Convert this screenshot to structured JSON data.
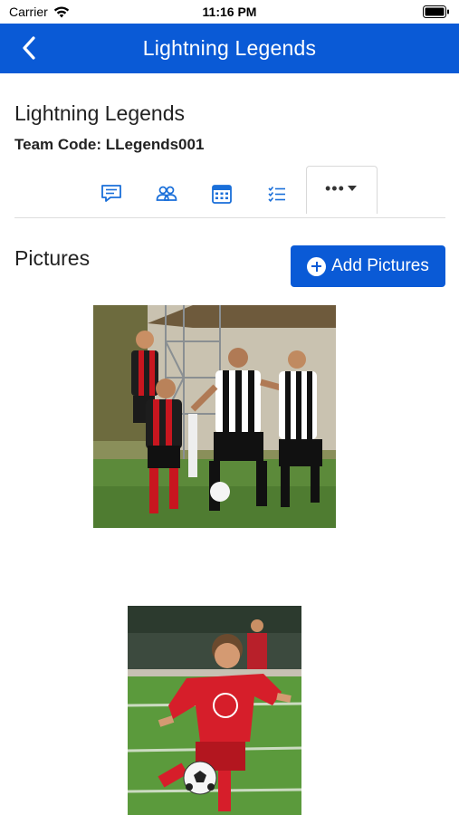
{
  "status_bar": {
    "carrier": "Carrier",
    "time": "11:16 PM"
  },
  "nav": {
    "title": "Lightning Legends",
    "back_icon": "chevron-left-icon"
  },
  "team": {
    "name": "Lightning Legends",
    "code": "Team Code: LLegends001"
  },
  "tabs": [
    {
      "icon": "message-icon"
    },
    {
      "icon": "people-icon"
    },
    {
      "icon": "calendar-icon"
    },
    {
      "icon": "checklist-icon"
    },
    {
      "icon": "more-icon",
      "label": "•••"
    }
  ],
  "pictures_section": {
    "title": "Pictures",
    "add_button_label": "Add Pictures",
    "items": [
      {
        "description": "team-soccer-match-photo"
      },
      {
        "description": "player-kicking-ball-photo"
      }
    ]
  },
  "colors": {
    "primary": "#0a5ad6",
    "text": "#222222",
    "divider": "#dddddd"
  }
}
